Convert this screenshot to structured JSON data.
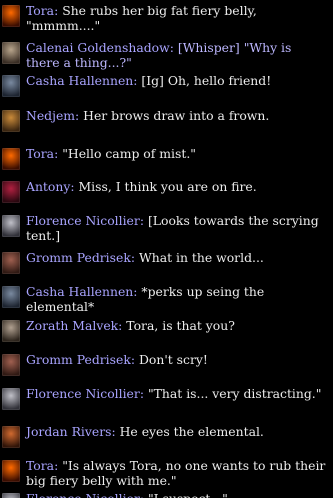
{
  "messages": [
    {
      "speaker": "Tora:",
      "text": "She rubs her big fat fiery belly, \"mmmm....\"",
      "avatar": "fire-elemental-avatar",
      "avatar_colors": [
        "#ff6a00",
        "#3a0d00"
      ],
      "whisper": false
    },
    {
      "speaker": "Calenai Goldenshadow:",
      "text": "[Whisper] \"Why is there a thing...?\"",
      "avatar": "woman-portrait-avatar",
      "avatar_colors": [
        "#b8a58c",
        "#3a2e25"
      ],
      "whisper": true
    },
    {
      "speaker": "Casha Hallennen:",
      "text": "[Ig] Oh, hello friend!",
      "avatar": "wolf-portrait-avatar",
      "avatar_colors": [
        "#7a8aa0",
        "#1d2430"
      ],
      "whisper": false
    },
    {
      "speaker": "Nedjem:",
      "text": "Her brows draw into a frown.",
      "avatar": "cat-portrait-avatar",
      "avatar_colors": [
        "#c98a3a",
        "#3a2510"
      ],
      "whisper": false
    },
    {
      "speaker": "Tora:",
      "text": "\"Hello camp of mist.\"",
      "avatar": "fire-elemental-avatar",
      "avatar_colors": [
        "#ff6a00",
        "#3a0d00"
      ],
      "whisper": false
    },
    {
      "speaker": "Antony:",
      "text": "Miss, I think you are on fire.",
      "avatar": "demon-portrait-avatar",
      "avatar_colors": [
        "#b02040",
        "#2a0810"
      ],
      "whisper": false
    },
    {
      "speaker": "Florence Nicollier:",
      "text": "[Looks towards the scrying tent.]",
      "avatar": "knight-portrait-avatar",
      "avatar_colors": [
        "#c0c0c8",
        "#303038"
      ],
      "whisper": false
    },
    {
      "speaker": "Gromm Pedrisek:",
      "text": "What in the world...",
      "avatar": "dwarf-portrait-avatar",
      "avatar_colors": [
        "#a06050",
        "#301a14"
      ],
      "whisper": false
    },
    {
      "speaker": "Casha Hallennen:",
      "text": "*perks up seing the elemental*",
      "avatar": "wolf-portrait-avatar",
      "avatar_colors": [
        "#7a8aa0",
        "#1d2430"
      ],
      "whisper": false
    },
    {
      "speaker": "Zorath Malvek:",
      "text": "Tora, is that you?",
      "avatar": "warrior-portrait-avatar",
      "avatar_colors": [
        "#b0a090",
        "#2c241c"
      ],
      "whisper": false
    },
    {
      "speaker": "Gromm Pedrisek:",
      "text": "Don't scry!",
      "avatar": "dwarf-portrait-avatar",
      "avatar_colors": [
        "#a06050",
        "#301a14"
      ],
      "whisper": false
    },
    {
      "speaker": "Florence Nicollier:",
      "text": "\"That is... very distracting.\"",
      "avatar": "knight-portrait-avatar",
      "avatar_colors": [
        "#c0c0c8",
        "#303038"
      ],
      "whisper": false
    },
    {
      "speaker": "Jordan Rivers:",
      "text": "He eyes the elemental.",
      "avatar": "rogue-portrait-avatar",
      "avatar_colors": [
        "#d06a30",
        "#301408"
      ],
      "whisper": false
    },
    {
      "speaker": "Tora:",
      "text": "\"Is always Tora, no one wants to rub their big fiery belly with me.\"",
      "avatar": "fire-elemental-avatar",
      "avatar_colors": [
        "#ff6a00",
        "#3a0d00"
      ],
      "whisper": false
    },
    {
      "speaker": "Florence Nicollier:",
      "text": "\"I suspect...\"",
      "avatar": "knight-portrait-avatar",
      "avatar_colors": [
        "#c0c0c8",
        "#303038"
      ],
      "whisper": false
    }
  ]
}
